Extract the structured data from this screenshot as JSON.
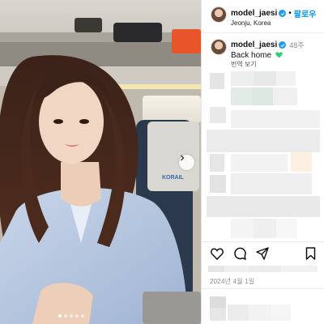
{
  "post": {
    "username": "model_jaesi",
    "separator": "•",
    "follow_label": "팔로우",
    "location": "Jeonju, Korea",
    "caption_username": "model_jaesi",
    "time_ago": "48주",
    "caption": "Back home",
    "translate_label": "번역 보기",
    "date": "2024년 4월 1일"
  },
  "photo": {
    "train_sign": "KORAIL",
    "carousel_count": 5,
    "carousel_active_index": 0
  },
  "icons": {
    "like": "heart-icon",
    "comment": "comment-icon",
    "share": "paper-plane-icon",
    "save": "bookmark-icon",
    "next": "chevron-right-icon",
    "verified": "verified-badge-icon",
    "caption_emoji": "green-heart-icon"
  },
  "colors": {
    "follow": "#0095f6",
    "verified": "#1d9bf0",
    "green_heart": "#2ecc71",
    "muted": "#8e8e8e"
  }
}
